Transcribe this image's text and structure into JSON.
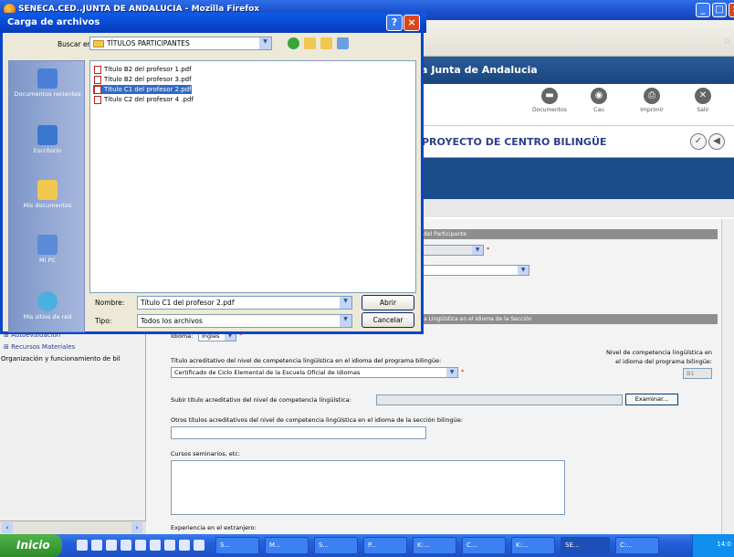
{
  "browser": {
    "title": "SENECA.CED..JUNTA DE ANDALUCIA - Mozilla Firefox",
    "banner": "e la Junta de Andalucia",
    "tools": [
      {
        "label": "Documentos",
        "icon": "documents-icon"
      },
      {
        "label": "Cau",
        "icon": "help-icon"
      },
      {
        "label": "Imprimir",
        "icon": "print-icon"
      },
      {
        "label": "Salir",
        "icon": "exit-icon"
      }
    ],
    "page_title": "PROYECTO DE CENTRO BILINGÜE"
  },
  "left_menu": [
    "Autoevaluación",
    "Recursos Materiales",
    "Organización y funcionamiento de bil"
  ],
  "form": {
    "section1": "s del Participante",
    "section2": "cia Lingüística en el Idioma de la Sección",
    "idioma_label": "Idioma:",
    "idioma_value": "Inglés",
    "titulo_label": "Título acreditativo del nivel de competencia lingüística en el idioma del programa bilingüe:",
    "titulo_value": "Certificado de Ciclo Elemental de la Escuela Oficial de Idiomas",
    "nivel_label_1": "Nivel de competencia lingüística en",
    "nivel_label_2": "el idioma del programa bilingüe:",
    "nivel_value": "B1",
    "subir_label": "Subir título acreditativo del nivel de competencia lingüística:",
    "examinar": "Examinar...",
    "otros_label": "Otros títulos acreditativos del nivel de competencia lingüística en el idioma de la sección bilingüe:",
    "cursos_label": "Cursos seminarios, etc:",
    "experiencia_label": "Experiencia en el extranjero:"
  },
  "dialog": {
    "title": "Carga de archivos",
    "lookin_label": "Buscar en:",
    "lookin_value": "TÍTULOS PARTICIPANTES",
    "places": [
      "Documentos recientes",
      "Escritorio",
      "Mis documentos",
      "Mi PC",
      "Mis sitios de red"
    ],
    "files": [
      {
        "name": "Título B2 del profesor 1.pdf",
        "selected": false
      },
      {
        "name": "Título B2 del profesor 3.pdf",
        "selected": false
      },
      {
        "name": "Título C1 del profesor 2.pdf",
        "selected": true
      },
      {
        "name": "Título C2 del profesor 4 .pdf",
        "selected": false
      }
    ],
    "name_label": "Nombre:",
    "name_value": "Título C1 del profesor 2.pdf",
    "type_label": "Tipo:",
    "type_value": "Todos los archivos",
    "open": "Abrir",
    "cancel": "Cancelar"
  },
  "taskbar": {
    "start": "Inicio",
    "buttons": [
      "S...",
      "M...",
      "S...",
      "P...",
      "K:...",
      "C...",
      "K:...",
      "SE...",
      "C:..."
    ],
    "clock": "14:0"
  }
}
